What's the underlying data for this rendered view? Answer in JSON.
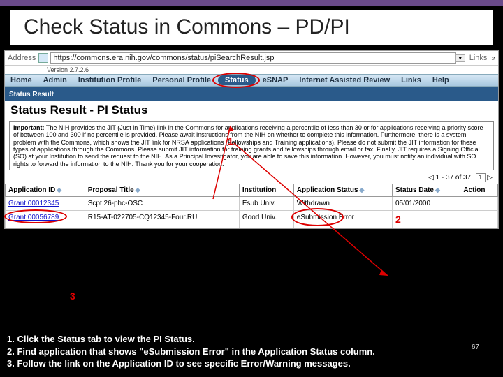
{
  "slide": {
    "title": "Check Status in Commons – PD/PI",
    "number": "67"
  },
  "browser": {
    "address_label": "Address",
    "url": "https://commons.era.nih.gov/commons/status/piSearchResult.jsp",
    "links_label": "Links",
    "chevron": "»"
  },
  "app": {
    "version": "Version 2.7.2.6"
  },
  "nav": {
    "home": "Home",
    "admin": "Admin",
    "inst_profile": "Institution Profile",
    "pers_profile": "Personal Profile",
    "status": "Status",
    "esnap": "eSNAP",
    "iar": "Internet Assisted Review",
    "links": "Links",
    "help": "Help"
  },
  "subnav": {
    "status_result": "Status Result"
  },
  "page": {
    "heading": "Status Result - PI Status"
  },
  "important": {
    "label": "Important:",
    "text": "The NIH provides the JIT (Just in Time) link in the Commons for applications receiving a percentile of less than 30 or for applications receiving a priority score of between 100 and 300 if no percentile is provided. Please await instructions from the NIH on whether to complete this information. Furthermore, there is a system problem with the Commons, which shows the JIT link for NRSA applications (Fellowships and Training applications). Please do not submit the JIT information for these types of applications through the Commons. Please submit JIT information for training grants and fellowships through email or fax. Finally, JIT requires a Signing Official (SO) at your Institution to send the request to the NIH. As a Principal Investigator, you are able to save this information. However, you must notify an individual with SO rights to forward the information to the NIH. Thank you for your cooperation."
  },
  "pager": {
    "range": "1 - 37 of 37",
    "page": "1"
  },
  "table": {
    "headers": {
      "app_id": "Application ID",
      "proposal": "Proposal Title",
      "institution": "Institution",
      "app_status": "Application Status",
      "status_date": "Status Date",
      "action": "Action"
    },
    "rows": [
      {
        "app_id": "Grant 00012345",
        "proposal": "Scpt 26-phc-OSC",
        "institution": "Esub Univ.",
        "status": "Withdrawn",
        "date": "05/01/2000",
        "action": ""
      },
      {
        "app_id": "Grant 00056789",
        "proposal": "R15-AT-022705-CQ12345-Four.RU",
        "institution": "Good Univ.",
        "status": "eSubmission Error",
        "date": "",
        "action": ""
      }
    ]
  },
  "callouts": {
    "c1": "1",
    "c2": "2",
    "c3": "3"
  },
  "instructions": {
    "l1": "1. Click the Status tab to view the PI Status.",
    "l2": "2. Find application that shows \"eSubmission Error\" in the Application Status column.",
    "l3": "3. Follow the link on the Application ID to see specific Error/Warning messages."
  }
}
